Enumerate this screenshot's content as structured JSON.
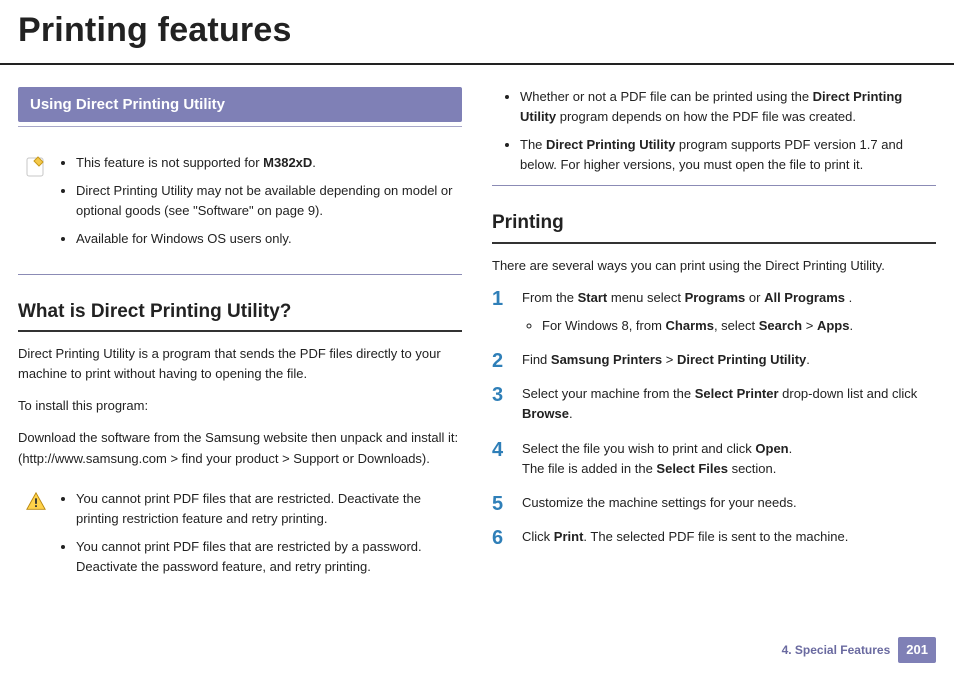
{
  "page": {
    "title": "Printing features",
    "chapter_label": "4.  Special Features",
    "page_number": "201"
  },
  "left": {
    "banner": "Using Direct Printing Utility",
    "note1": {
      "items": [
        "This feature is not supported for <b>M382xD</b>.",
        " Direct Printing Utility may not be available depending on model or optional goods (see \"Software\" on page 9).",
        "Available for Windows OS users only."
      ]
    },
    "what_head": "What is Direct Printing Utility?",
    "para1": "Direct Printing Utility is a program that sends the PDF files directly to your machine to print without having to opening the file.",
    "para2": "To install this program:",
    "para3": "Download the software from the Samsung website then unpack and install it: (http://www.samsung.com > find your product > Support or Downloads).",
    "warn": {
      "items": [
        "You cannot print PDF files that are restricted. Deactivate the printing restriction feature and retry printing.",
        "You cannot print PDF files that are restricted by a password. Deactivate the password feature, and retry printing."
      ]
    }
  },
  "right": {
    "top_items": [
      "Whether or not a PDF file can be printed using the <b>Direct Printing Utility</b> program depends on how the PDF file was created.",
      "The <b>Direct Printing Utility</b> program supports PDF version 1.7 and below. For higher versions, you must open the file to print it."
    ],
    "printing_head": "Printing",
    "printing_intro": "There are several ways you can print using the Direct Printing Utility.",
    "steps": [
      {
        "text": "From the <b>Start</b> menu select <b>Programs</b> or <b>All Programs</b> .",
        "sub": [
          "For Windows 8, from <b>Charms</b>, select <b>Search</b> > <b>Apps</b>."
        ]
      },
      {
        "text": "Find <b>Samsung Printers</b> > <b>Direct Printing Utility</b>."
      },
      {
        "text": "Select your machine from the <b>Select Printer</b> drop-down list and click <b>Browse</b>."
      },
      {
        "text": "Select the file you wish to print and click <b>Open</b>.<br>The file is added in the <b>Select Files</b> section."
      },
      {
        "text": "Customize the machine settings for your needs."
      },
      {
        "text": "Click <b>Print</b>. The selected PDF file is sent to the machine."
      }
    ]
  }
}
